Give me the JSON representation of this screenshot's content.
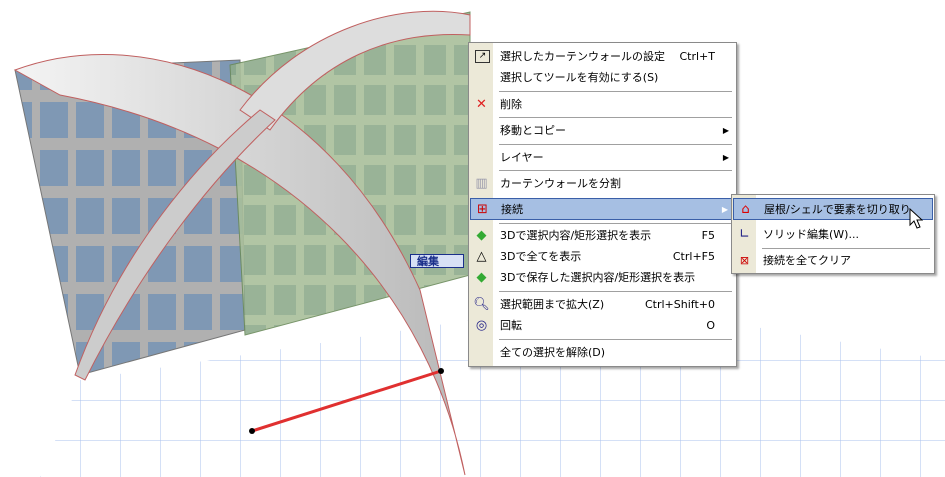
{
  "edit_tag": "編集",
  "context_menu": {
    "items": [
      {
        "icon": "curtain-wall-settings-icon",
        "label": "選択したカーテンウォールの設定",
        "shortcut": "Ctrl+T"
      },
      {
        "icon": "",
        "label": "選択してツールを有効にする(S)",
        "shortcut": ""
      },
      {
        "icon": "delete-icon",
        "label": "削除",
        "shortcut": ""
      },
      {
        "icon": "",
        "label": "移動とコピー",
        "shortcut": "",
        "submenu": true
      },
      {
        "icon": "",
        "label": "レイヤー",
        "shortcut": "",
        "submenu": true
      },
      {
        "icon": "split-curtain-wall-icon",
        "label": "カーテンウォールを分割",
        "shortcut": ""
      },
      {
        "icon": "connect-icon",
        "label": "接続",
        "shortcut": "",
        "submenu": true
      },
      {
        "icon": "show-selection-3d-icon",
        "label": "3Dで選択内容/矩形選択を表示",
        "shortcut": "F5"
      },
      {
        "icon": "show-all-3d-icon",
        "label": "3Dで全てを表示",
        "shortcut": "Ctrl+F5"
      },
      {
        "icon": "show-saved-selection-3d-icon",
        "label": "3Dで保存した選択内容/矩形選択を表示",
        "shortcut": ""
      },
      {
        "icon": "zoom-to-selection-icon",
        "label": "選択範囲まで拡大(Z)",
        "shortcut": "Ctrl+Shift+0"
      },
      {
        "icon": "orbit-icon",
        "label": "回転",
        "shortcut": "O"
      },
      {
        "icon": "",
        "label": "全ての選択を解除(D)",
        "shortcut": ""
      }
    ]
  },
  "submenu": {
    "items": [
      {
        "icon": "trim-to-roof-icon",
        "label": "屋根/シェルで要素を切り取り"
      },
      {
        "icon": "solid-edit-icon",
        "label": "ソリッド編集(W)..."
      },
      {
        "icon": "clear-connections-icon",
        "label": "接続を全てクリア"
      }
    ]
  }
}
